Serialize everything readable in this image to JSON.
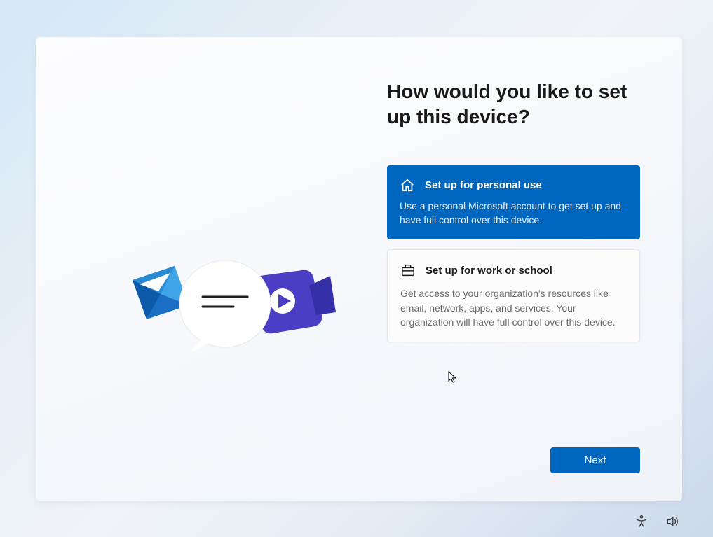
{
  "heading": "How would you like to set up this device?",
  "options": {
    "personal": {
      "title": "Set up for personal use",
      "description": "Use a personal Microsoft account to get set up and have full control over this device.",
      "selected": true
    },
    "work": {
      "title": "Set up for work or school",
      "description": "Get access to your organization's resources like email, network, apps, and services. Your organization will have full control over this device.",
      "selected": false
    }
  },
  "buttons": {
    "next": "Next"
  }
}
